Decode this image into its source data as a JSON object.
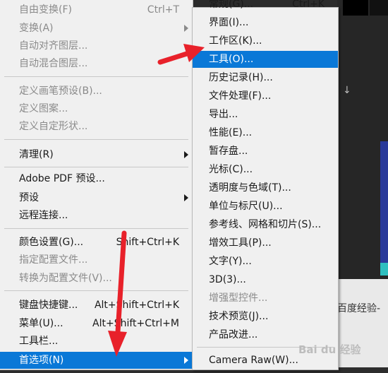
{
  "background": {
    "watermark_text": "百度经验-",
    "watermark_logo": "Bai du 经验",
    "arrow_glyph": "↓"
  },
  "left_menu": {
    "items": [
      {
        "label": "自由变换(F)",
        "shortcut": "Ctrl+T",
        "disabled": true,
        "submenu": false
      },
      {
        "label": "变换(A)",
        "shortcut": "",
        "disabled": true,
        "submenu": true
      },
      {
        "label": "自动对齐图层...",
        "shortcut": "",
        "disabled": true,
        "submenu": false
      },
      {
        "label": "自动混合图层...",
        "shortcut": "",
        "disabled": true,
        "submenu": false
      },
      {
        "label": "定义画笔预设(B)...",
        "shortcut": "",
        "disabled": true,
        "submenu": false
      },
      {
        "label": "定义图案...",
        "shortcut": "",
        "disabled": true,
        "submenu": false
      },
      {
        "label": "定义自定形状...",
        "shortcut": "",
        "disabled": true,
        "submenu": false
      },
      {
        "label": "清理(R)",
        "shortcut": "",
        "disabled": false,
        "submenu": true
      },
      {
        "label": "Adobe PDF 预设...",
        "shortcut": "",
        "disabled": false,
        "submenu": false
      },
      {
        "label": "预设",
        "shortcut": "",
        "disabled": false,
        "submenu": true
      },
      {
        "label": "远程连接...",
        "shortcut": "",
        "disabled": false,
        "submenu": false
      },
      {
        "label": "颜色设置(G)...",
        "shortcut": "Shift+Ctrl+K",
        "disabled": false,
        "submenu": false
      },
      {
        "label": "指定配置文件...",
        "shortcut": "",
        "disabled": true,
        "submenu": false
      },
      {
        "label": "转换为配置文件(V)...",
        "shortcut": "",
        "disabled": true,
        "submenu": false
      },
      {
        "label": "键盘快捷键...",
        "shortcut": "Alt+Shift+Ctrl+K",
        "disabled": false,
        "submenu": false
      },
      {
        "label": "菜单(U)...",
        "shortcut": "Alt+Shift+Ctrl+M",
        "disabled": false,
        "submenu": false
      },
      {
        "label": "工具栏...",
        "shortcut": "",
        "disabled": false,
        "submenu": false
      },
      {
        "label": "首选项(N)",
        "shortcut": "",
        "disabled": false,
        "submenu": true,
        "selected": true
      }
    ]
  },
  "right_menu": {
    "items": [
      {
        "label": "常规(G)...",
        "shortcut": "Ctrl+K"
      },
      {
        "label": "界面(I)..."
      },
      {
        "label": "工作区(K)..."
      },
      {
        "label": "工具(O)...",
        "selected": true
      },
      {
        "label": "历史记录(H)..."
      },
      {
        "label": "文件处理(F)..."
      },
      {
        "label": "导出..."
      },
      {
        "label": "性能(E)..."
      },
      {
        "label": "暂存盘..."
      },
      {
        "label": "光标(C)..."
      },
      {
        "label": "透明度与色域(T)..."
      },
      {
        "label": "单位与标尺(U)..."
      },
      {
        "label": "参考线、网格和切片(S)..."
      },
      {
        "label": "增效工具(P)..."
      },
      {
        "label": "文字(Y)..."
      },
      {
        "label": "3D(3)..."
      },
      {
        "label": "增强型控件...",
        "disabled": true
      },
      {
        "label": "技术预览(J)..."
      },
      {
        "label": "产品改进..."
      },
      {
        "label": "Camera Raw(W)..."
      }
    ]
  },
  "colors": {
    "highlight": "#0a78d7",
    "annotation": "#e8212a",
    "menu_bg": "#f0f0f0"
  }
}
